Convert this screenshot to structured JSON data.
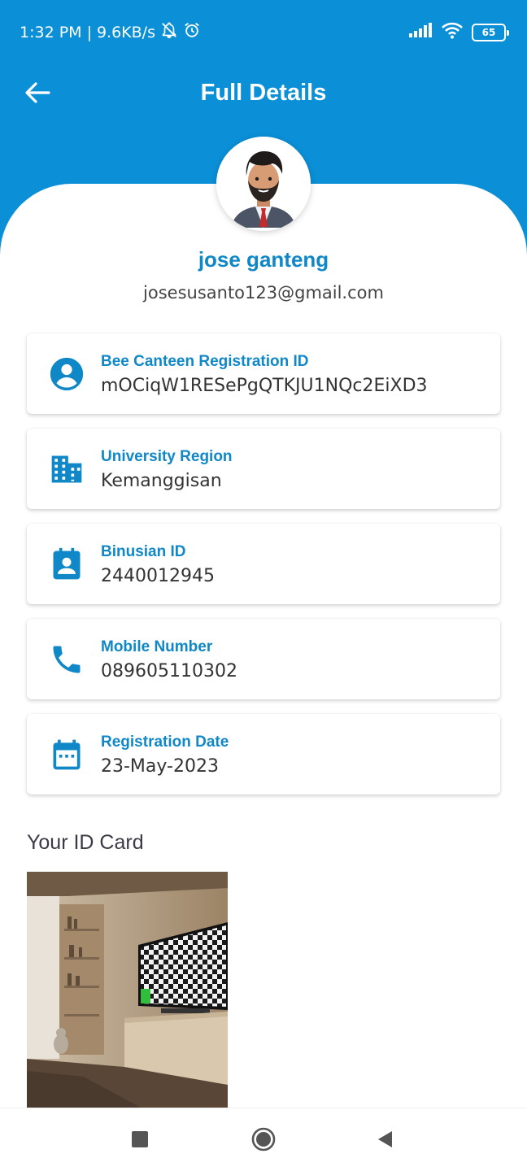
{
  "status_bar": {
    "time": "1:32 PM",
    "speed": "9.6KB/s",
    "battery": "65",
    "icons": [
      "bell-off-icon",
      "alarm-icon",
      "signal-icon",
      "wifi-icon",
      "battery-icon"
    ]
  },
  "app_bar": {
    "title": "Full Details",
    "back_icon": "arrow-left-icon"
  },
  "profile": {
    "name": "jose ganteng",
    "email": "josesusanto123@gmail.com"
  },
  "details": [
    {
      "icon": "account-circle-icon",
      "label": "Bee Canteen Registration ID",
      "value": "mOCiqW1RESePgQTKJU1NQc2EiXD3"
    },
    {
      "icon": "building-icon",
      "label": "University Region",
      "value": "Kemanggisan"
    },
    {
      "icon": "contact-badge-icon",
      "label": "Binusian ID",
      "value": "2440012945"
    },
    {
      "icon": "phone-icon",
      "label": "Mobile Number",
      "value": "089605110302"
    },
    {
      "icon": "calendar-icon",
      "label": "Registration Date",
      "value": "23-May-2023"
    }
  ],
  "id_card": {
    "heading": "Your ID Card"
  },
  "colors": {
    "primary": "#0b8fd6",
    "label": "#1088c8",
    "text": "#333333"
  }
}
